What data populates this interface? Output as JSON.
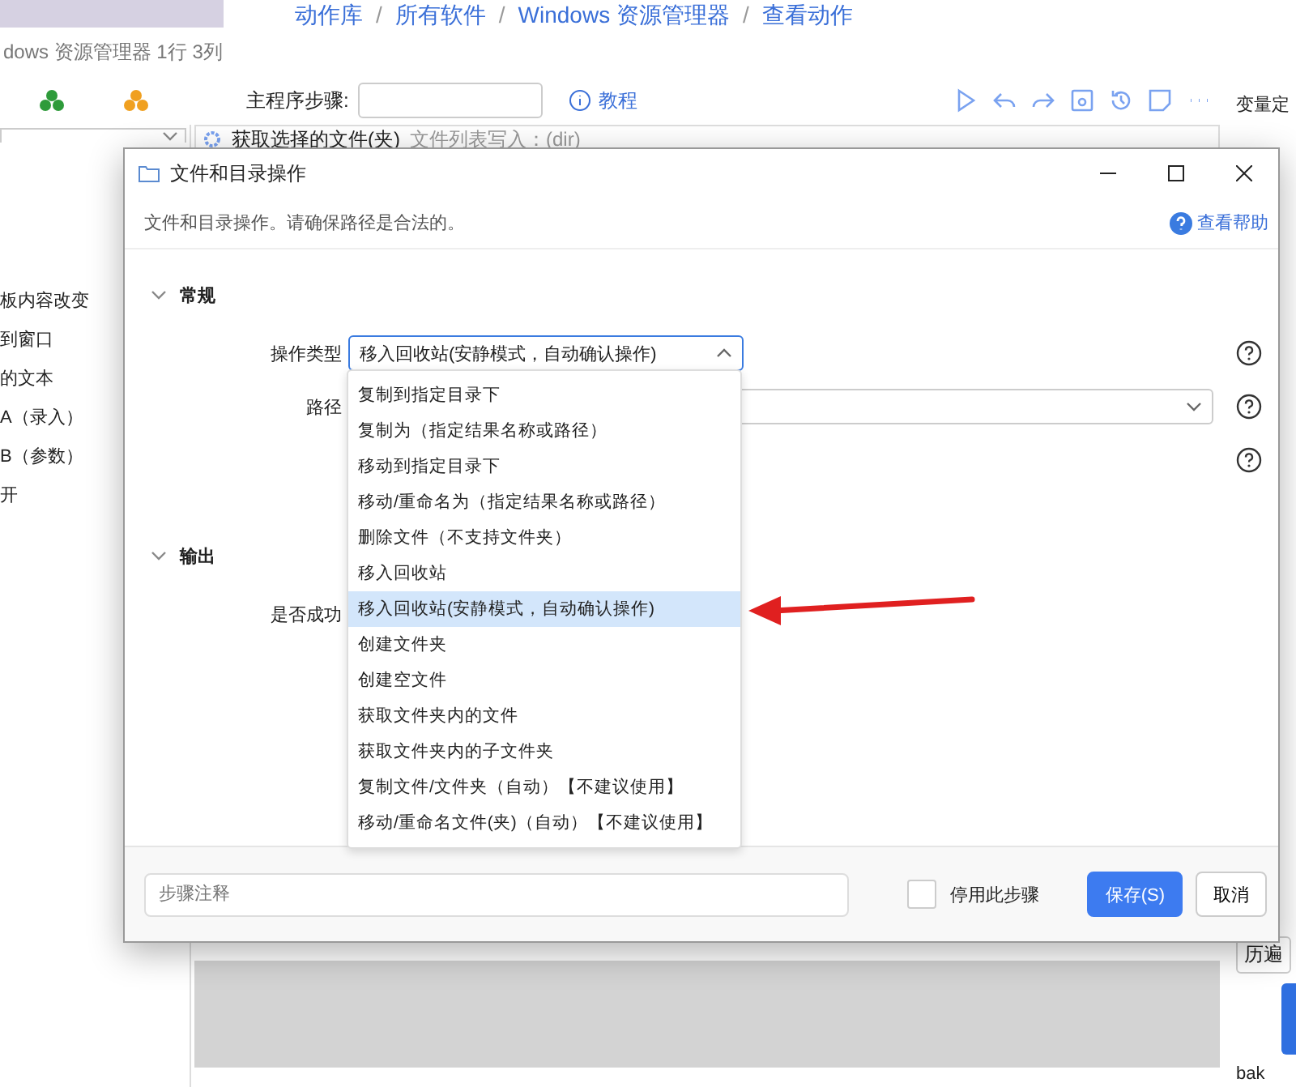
{
  "breadcrumb": [
    {
      "text": "动作库",
      "separator": "/"
    },
    {
      "text": "所有软件",
      "separator": "/"
    },
    {
      "text": "Windows 资源管理器",
      "separator": "/"
    },
    {
      "text": "查看动作"
    }
  ],
  "back_window": {
    "title": "dows 资源管理器 1行 3列",
    "main_step_label": "主程序步骤:",
    "tutorial": "教程",
    "step_title": "获取选择的文件(夹)",
    "step_detail": "文件列表写入：(dir)",
    "variables_title": "变量定",
    "loop_button": "历遍",
    "bottom_tag": "bak",
    "left_items": [
      {
        "text": "板内容改变"
      },
      {
        "text": "到窗口"
      },
      {
        "text": "的文本"
      },
      {
        "text": "A（录入）"
      },
      {
        "text": "B（参数）"
      },
      {
        "text": "开"
      }
    ]
  },
  "dialog": {
    "title": "文件和目录操作",
    "description": "文件和目录操作。请确保路径是合法的。",
    "help_link": "查看帮助",
    "sections": [
      {
        "title": "常规",
        "expanded": true,
        "rows": [
          {
            "kind": "select",
            "label": "操作类型",
            "value": "移入回收站(安静模式，自动确认操作)",
            "expanded": true
          },
          {
            "kind": "select",
            "label": "路径",
            "expanded": false
          },
          {
            "kind": "blank"
          }
        ]
      },
      {
        "title": "输出",
        "expanded": true,
        "rows": [
          {
            "kind": "output",
            "label": "是否成功"
          }
        ]
      }
    ],
    "options": [
      {
        "text": "复制到指定目录下",
        "selected": false
      },
      {
        "text": "复制为（指定结果名称或路径）",
        "selected": false
      },
      {
        "text": "移动到指定目录下",
        "selected": false
      },
      {
        "text": "移动/重命名为（指定结果名称或路径）",
        "selected": false
      },
      {
        "text": "删除文件（不支持文件夹）",
        "selected": false
      },
      {
        "text": "移入回收站",
        "selected": false
      },
      {
        "text": "移入回收站(安静模式，自动确认操作)",
        "selected": true
      },
      {
        "text": "创建文件夹",
        "selected": false
      },
      {
        "text": "创建空文件",
        "selected": false
      },
      {
        "text": "获取文件夹内的文件",
        "selected": false
      },
      {
        "text": "获取文件夹内的子文件夹",
        "selected": false
      },
      {
        "text": "复制文件/文件夹（自动）【不建议使用】",
        "selected": false
      },
      {
        "text": "移动/重命名文件(夹)（自动）【不建议使用】",
        "selected": false
      }
    ],
    "comment_placeholder": "步骤注释",
    "disable_label": "停用此步骤",
    "disable_checked": false,
    "save_button": "保存(S)",
    "cancel_button": "取消"
  }
}
